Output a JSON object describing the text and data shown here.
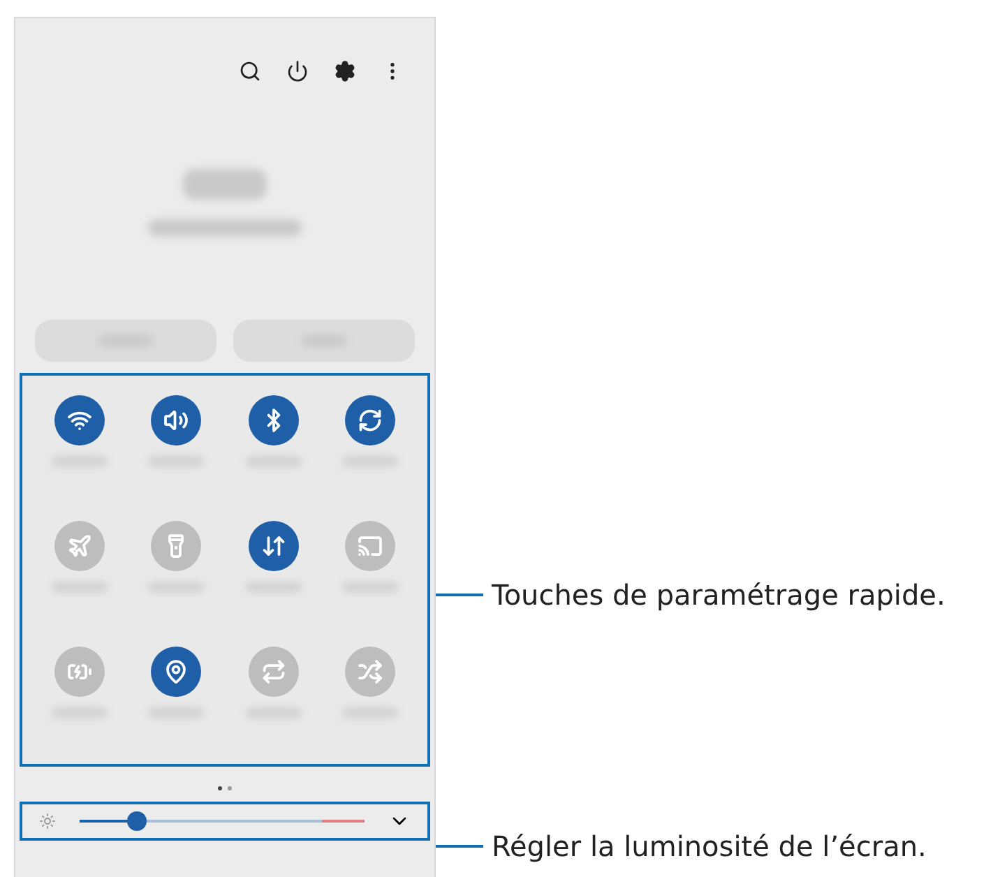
{
  "quick_panel": {
    "tiles": [
      {
        "on": true
      },
      {
        "on": true
      },
      {
        "on": true
      },
      {
        "on": true
      },
      {
        "on": false
      },
      {
        "on": false
      },
      {
        "on": true
      },
      {
        "on": false
      },
      {
        "on": false
      },
      {
        "on": true
      },
      {
        "on": false
      },
      {
        "on": false
      }
    ],
    "pages": [
      {
        "selected": true
      },
      {
        "selected": false
      }
    ],
    "brightness": {
      "level": 0.2
    }
  },
  "callouts": [
    {
      "text": "Touches de paramétrage rapide."
    },
    {
      "text": "Régler la luminosité de l’écran."
    }
  ]
}
